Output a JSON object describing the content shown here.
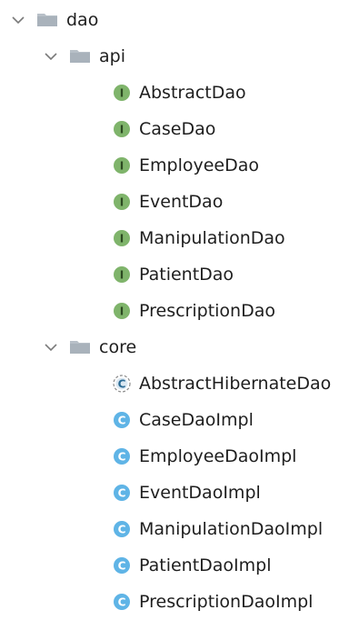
{
  "colors": {
    "interface_icon": "#7fb46b",
    "class_icon": "#5fb4e6",
    "folder": "#b8c0c8",
    "chevron": "#7a7a7a",
    "text": "#1e1e1e"
  },
  "tree": {
    "root": {
      "label": "dao",
      "expanded": true,
      "icon": "folder-icon",
      "children": [
        {
          "label": "api",
          "expanded": true,
          "icon": "folder-icon",
          "items": [
            {
              "label": "AbstractDao",
              "kind": "interface",
              "icon_letter": "I"
            },
            {
              "label": "CaseDao",
              "kind": "interface",
              "icon_letter": "I"
            },
            {
              "label": "EmployeeDao",
              "kind": "interface",
              "icon_letter": "I"
            },
            {
              "label": "EventDao",
              "kind": "interface",
              "icon_letter": "I"
            },
            {
              "label": "ManipulationDao",
              "kind": "interface",
              "icon_letter": "I"
            },
            {
              "label": "PatientDao",
              "kind": "interface",
              "icon_letter": "I"
            },
            {
              "label": "PrescriptionDao",
              "kind": "interface",
              "icon_letter": "I"
            }
          ]
        },
        {
          "label": "core",
          "expanded": true,
          "icon": "folder-icon",
          "items": [
            {
              "label": "AbstractHibernateDao",
              "kind": "abstract-class",
              "icon_letter": "C"
            },
            {
              "label": "CaseDaoImpl",
              "kind": "class",
              "icon_letter": "C"
            },
            {
              "label": "EmployeeDaoImpl",
              "kind": "class",
              "icon_letter": "C"
            },
            {
              "label": "EventDaoImpl",
              "kind": "class",
              "icon_letter": "C"
            },
            {
              "label": "ManipulationDaoImpl",
              "kind": "class",
              "icon_letter": "C"
            },
            {
              "label": "PatientDaoImpl",
              "kind": "class",
              "icon_letter": "C"
            },
            {
              "label": "PrescriptionDaoImpl",
              "kind": "class",
              "icon_letter": "C"
            }
          ]
        }
      ]
    }
  }
}
